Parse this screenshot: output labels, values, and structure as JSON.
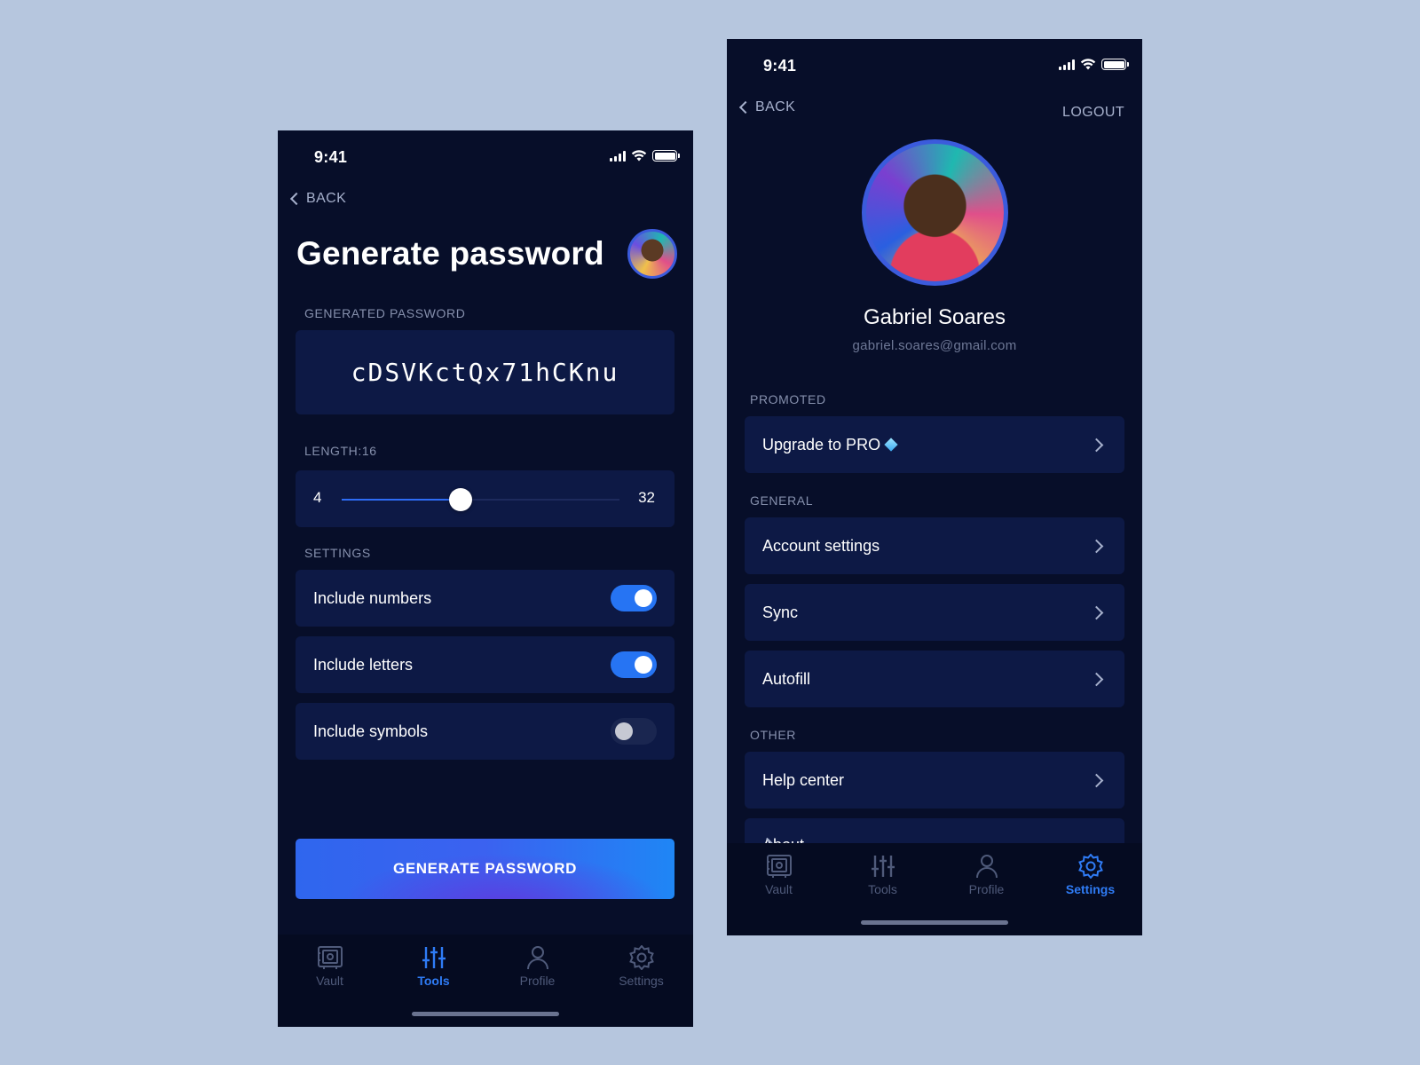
{
  "colors": {
    "background": "#b6c6de",
    "phone_bg": "#070e29",
    "card_bg": "#0d1945",
    "accent": "#2f7cf6",
    "muted_text": "#8690ad"
  },
  "left": {
    "status": {
      "time": "9:41"
    },
    "back_label": "BACK",
    "title": "Generate password",
    "generated_label": "GENERATED PASSWORD",
    "password": "cDSVKctQx71hCKnu",
    "length_label": "LENGTH:16",
    "slider": {
      "min": "4",
      "max": "32",
      "value": 16,
      "min_value": 4,
      "max_value": 32
    },
    "settings_label": "SETTINGS",
    "toggles": [
      {
        "label": "Include numbers",
        "on": true
      },
      {
        "label": "Include letters",
        "on": true
      },
      {
        "label": "Include symbols",
        "on": false
      }
    ],
    "generate_button": "GENERATE PASSWORD",
    "tabs": [
      {
        "label": "Vault",
        "icon": "vault-icon",
        "active": false
      },
      {
        "label": "Tools",
        "icon": "tools-icon",
        "active": true
      },
      {
        "label": "Profile",
        "icon": "profile-icon",
        "active": false
      },
      {
        "label": "Settings",
        "icon": "gear-icon",
        "active": false
      }
    ]
  },
  "right": {
    "status": {
      "time": "9:41"
    },
    "back_label": "BACK",
    "logout_label": "LOGOUT",
    "profile": {
      "name": "Gabriel Soares",
      "email": "gabriel.soares@gmail.com"
    },
    "promoted_label": "PROMOTED",
    "promoted_items": [
      {
        "label": "Upgrade to PRO",
        "icon": "diamond-icon"
      }
    ],
    "general_label": "GENERAL",
    "general_items": [
      {
        "label": "Account settings"
      },
      {
        "label": "Sync"
      },
      {
        "label": "Autofill"
      }
    ],
    "other_label": "OTHER",
    "other_items": [
      {
        "label": "Help center"
      },
      {
        "label": "About"
      }
    ],
    "tabs": [
      {
        "label": "Vault",
        "icon": "vault-icon",
        "active": false
      },
      {
        "label": "Tools",
        "icon": "tools-icon",
        "active": false
      },
      {
        "label": "Profile",
        "icon": "profile-icon",
        "active": false
      },
      {
        "label": "Settings",
        "icon": "gear-icon",
        "active": true
      }
    ]
  }
}
